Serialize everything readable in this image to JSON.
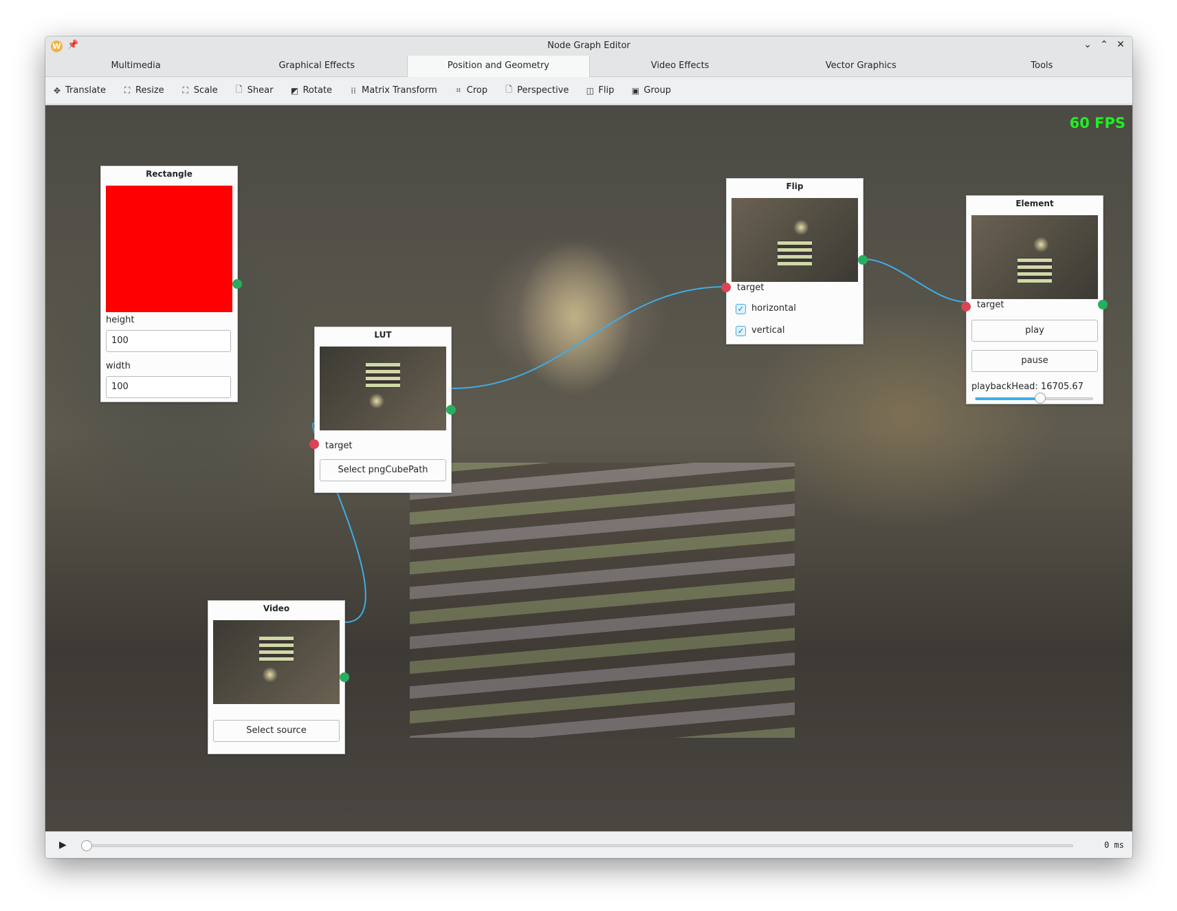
{
  "window": {
    "title": "Node Graph Editor"
  },
  "tabs": [
    {
      "label": "Multimedia",
      "active": false
    },
    {
      "label": "Graphical Effects",
      "active": false
    },
    {
      "label": "Position and Geometry",
      "active": true
    },
    {
      "label": "Video Effects",
      "active": false
    },
    {
      "label": "Vector Graphics",
      "active": false
    },
    {
      "label": "Tools",
      "active": false
    }
  ],
  "toolbar": [
    {
      "label": "Translate",
      "icon": "move-icon"
    },
    {
      "label": "Resize",
      "icon": "resize-icon"
    },
    {
      "label": "Scale",
      "icon": "scale-icon"
    },
    {
      "label": "Shear",
      "icon": "document-icon"
    },
    {
      "label": "Rotate",
      "icon": "rotate-icon"
    },
    {
      "label": "Matrix Transform",
      "icon": "grid-dots-icon"
    },
    {
      "label": "Crop",
      "icon": "crop-icon"
    },
    {
      "label": "Perspective",
      "icon": "document-icon"
    },
    {
      "label": "Flip",
      "icon": "flip-icon"
    },
    {
      "label": "Group",
      "icon": "group-icon"
    }
  ],
  "canvas": {
    "fps": "60 FPS"
  },
  "nodes": {
    "rectangle": {
      "title": "Rectangle",
      "color": "#ff0000",
      "height_label": "height",
      "height_value": "100",
      "width_label": "width",
      "width_value": "100"
    },
    "lut": {
      "title": "LUT",
      "target_label": "target",
      "button": "Select pngCubePath"
    },
    "video": {
      "title": "Video",
      "button": "Select source"
    },
    "flip": {
      "title": "Flip",
      "target_label": "target",
      "horizontal_label": "horizontal",
      "horizontal_checked": true,
      "vertical_label": "vertical",
      "vertical_checked": true
    },
    "element": {
      "title": "Element",
      "target_label": "target",
      "play": "play",
      "pause": "pause",
      "playback_label": "playbackHead: 16705.67",
      "playback_fraction": 0.55
    }
  },
  "timeline": {
    "time": "0 ms",
    "position": 0
  },
  "colors": {
    "accent": "#3daee9",
    "out_port": "#27ae60",
    "in_port": "#da4453",
    "fps": "#22ee22"
  }
}
